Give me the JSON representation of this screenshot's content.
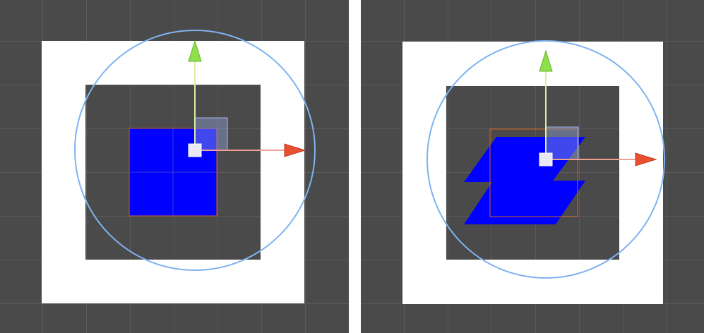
{
  "scene": {
    "grid_color": "#4a4a4a",
    "grid_line_color": "#6a6a6a",
    "frame_color": "#ffffff",
    "inner_color": "#4a4a4a",
    "shape_color": "#0000ff",
    "outline_color": "#d06020",
    "ring_color": "#7fb3f0",
    "handle_color": "#e8e8f8",
    "arrow_y_color": "#8ee04a",
    "arrow_y_shaft": "#d8f0a0",
    "arrow_x_color": "#e85030",
    "arrow_x_shaft": "#f0a090",
    "plane_handle_color": "#8ea0d8"
  },
  "views": [
    {
      "label": "",
      "shape": "square"
    },
    {
      "label": "",
      "shape": "skewed-zigzag"
    }
  ]
}
